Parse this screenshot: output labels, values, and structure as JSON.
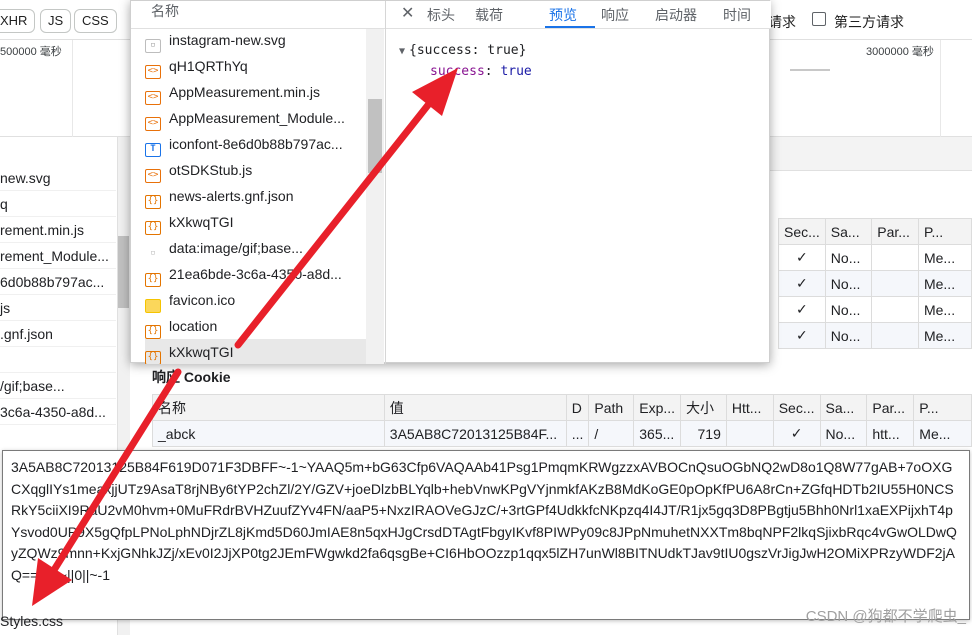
{
  "filterbar": {
    "chips": [
      "XHR",
      "JS",
      "CSS"
    ],
    "request_text": "请求",
    "third_party_label": "第三方请求"
  },
  "timeline": {
    "left_label": "500000 毫秒",
    "right_label": "3000000 毫秒"
  },
  "left_list": {
    "items": [
      "new.svg",
      "q",
      "rement.min.js",
      "rement_Module...",
      "6d0b88b797ac...",
      "js",
      ".gnf.json",
      "",
      "/gif;base...",
      "3c6a-4350-a8d..."
    ]
  },
  "panel": {
    "header": {
      "name_col": "名称",
      "tabs": [
        "标头",
        "载荷",
        "预览",
        "响应",
        "启动器",
        "时间"
      ],
      "active_tab": "预览"
    },
    "rows": [
      {
        "icon": "img-icon",
        "glyph": "",
        "name": "instagram-new.svg"
      },
      {
        "icon": "js-icon",
        "glyph": "<>",
        "name": "qH1QRThYq"
      },
      {
        "icon": "js-icon",
        "glyph": "<>",
        "name": "AppMeasurement.min.js"
      },
      {
        "icon": "js-icon",
        "glyph": "<>",
        "name": "AppMeasurement_Module..."
      },
      {
        "icon": "txt-icon",
        "glyph": "T",
        "name": "iconfont-8e6d0b88b797ac..."
      },
      {
        "icon": "js-icon",
        "glyph": "<>",
        "name": "otSDKStub.js"
      },
      {
        "icon": "json-icon",
        "glyph": "{}",
        "name": "news-alerts.gnf.json"
      },
      {
        "icon": "json-icon",
        "glyph": "{}",
        "name": "kXkwqTGI"
      },
      {
        "icon": "gif-icon",
        "glyph": "",
        "name": "data:image/gif;base..."
      },
      {
        "icon": "json-icon",
        "glyph": "{}",
        "name": "21ea6bde-3c6a-4350-a8d..."
      },
      {
        "icon": "ico-icon",
        "glyph": "",
        "name": "favicon.ico"
      },
      {
        "icon": "json-icon",
        "glyph": "{}",
        "name": "location"
      },
      {
        "icon": "json-icon",
        "glyph": "{}",
        "name": "kXkwqTGI"
      }
    ],
    "preview": {
      "root_line": "{success: true}",
      "key": "success",
      "value": "true"
    }
  },
  "request_cookie_table": {
    "headers": [
      "Sec...",
      "Sa...",
      "Par...",
      "P..."
    ],
    "rows": [
      [
        "✓",
        "No...",
        "",
        "Me..."
      ],
      [
        "✓",
        "No...",
        "",
        "Me..."
      ],
      [
        "✓",
        "No...",
        "",
        "Me..."
      ],
      [
        "✓",
        "No...",
        "",
        "Me..."
      ]
    ]
  },
  "response_cookie": {
    "title": "响应 Cookie",
    "headers": [
      "名称",
      "值",
      "D",
      "Path",
      "Exp...",
      "大小",
      "Htt...",
      "Sec...",
      "Sa...",
      "Par...",
      "P..."
    ],
    "row": [
      "_abck",
      "3A5AB8C72013125B84F...",
      "...",
      "/",
      "365...",
      "719",
      "",
      "✓",
      "No...",
      "htt...",
      "Me..."
    ]
  },
  "tooltip": {
    "value": "3A5AB8C72013125B84F619D071F3DBFF~-1~YAAQ5m+bG63Cfp6VAQAAb41Psg1PmqmKRWgzzxAVBOCnQsuOGbNQ2wD8o1Q8W77gAB+7oOXGCXqglIYs1meaxjjUTz9AsaT8rjNBy6tYP2chZl/2Y/GZV+joeDlzbBLYqlb+hebVnwKPgVYjnmkfAKzB8MdKoGE0pOpKfPU6A8rCn+ZGfqHDTb2IU55H0NCSRkY5ciiXI9RaU2vM0hvm+0MuFRdrBVHZuufZYv4FN/aaP5+NxzIRAOVeGJzC/+3rtGPf4UdkkfcNKpzq4I4JT/R1jx5gq3D8PBgtju5Bhh0Nrl1xaEXPijxhT4pYsvod0UP9X5gQfpLPNoLphNDjrZL8jKmd5D60JmIAE8n5qxHJgCrsdDTAgtFbgyIKvf8PIWPy09c8JPpNmuhetNXXTm8bqNPF2lkqSjixbRqc4vGwOLDwQyZQWz9mnn+KxjGNhkJZj/xEv0I2JjXP0tg2JEmFWgwkd2fa6qsgBe+CI6HbOOzzp1qqx5lZH7unWl8BITNUdkTJav9tIU0gszVrJigJwH2OMiXPRzyWDF2jAQ==~-1~||0||~-1"
  },
  "bottom_file": "Styles.css",
  "watermark": "CSDN @狗都不学爬虫_"
}
